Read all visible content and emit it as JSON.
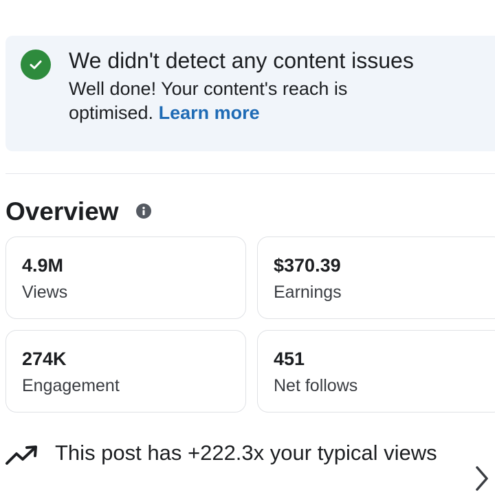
{
  "notice": {
    "icon": "check-circle-icon",
    "title": "We didn't detect any content issues",
    "body": "Well done! Your content's reach is optimised.",
    "link": "Learn more",
    "accent": "#2e8b3d",
    "link_color": "#1f6bb5"
  },
  "overview": {
    "title": "Overview",
    "info_icon": "info-icon",
    "cards": [
      {
        "value": "4.9M",
        "label": "Views"
      },
      {
        "value": "$370.39",
        "label": "Earnings"
      },
      {
        "value": "274K",
        "label": "Engagement"
      },
      {
        "value": "451",
        "label": "Net follows"
      }
    ]
  },
  "insight": {
    "icon": "trending-up-icon",
    "text": "This post has +222.3x your typical views",
    "chevron": "chevron-right-icon"
  }
}
